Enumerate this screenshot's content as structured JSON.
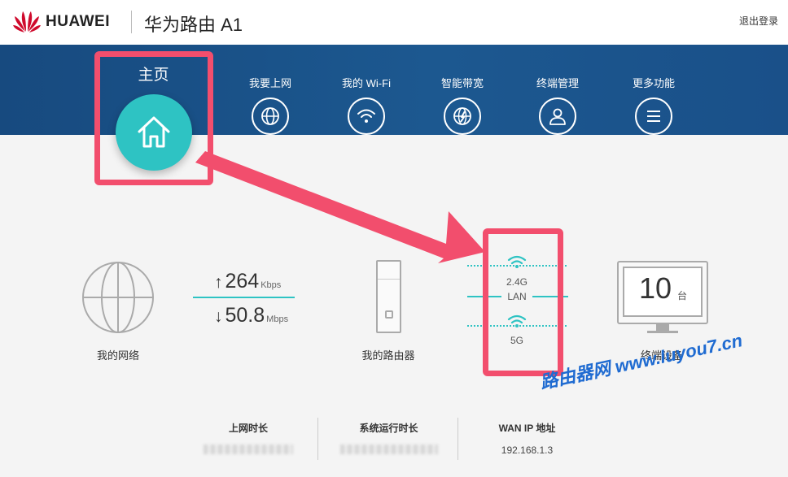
{
  "header": {
    "brand": "HUAWEI",
    "product": "华为路由 A1",
    "logout": "退出登录",
    "brand_color": "#cf0a2c"
  },
  "nav": {
    "home": "主页",
    "items": [
      {
        "label": "我要上网",
        "icon": "globe-icon"
      },
      {
        "label": "我的 Wi-Fi",
        "icon": "wifi-icon"
      },
      {
        "label": "智能带宽",
        "icon": "bandwidth-icon"
      },
      {
        "label": "终端管理",
        "icon": "user-icon"
      },
      {
        "label": "更多功能",
        "icon": "menu-icon"
      }
    ],
    "band_color": "#1c5890",
    "home_color": "#2ec3c3"
  },
  "status": {
    "network_label": "我的网络",
    "upload_value": "264",
    "upload_unit": "Kbps",
    "download_value": "50.8",
    "download_unit": "Mbps",
    "router_label": "我的路由器",
    "band_24": "2.4G",
    "lan": "LAN",
    "band_5": "5G",
    "devices_count": "10",
    "devices_unit": "台",
    "devices_label": "终端设备"
  },
  "info": {
    "online_time_title": "上网时长",
    "uptime_title": "系统运行时长",
    "wan_ip_title": "WAN IP 地址",
    "wan_ip": "192.168.1.3"
  },
  "watermark": "路由器网 www.luyou7.cn",
  "annotation_color": "#f24e6d"
}
